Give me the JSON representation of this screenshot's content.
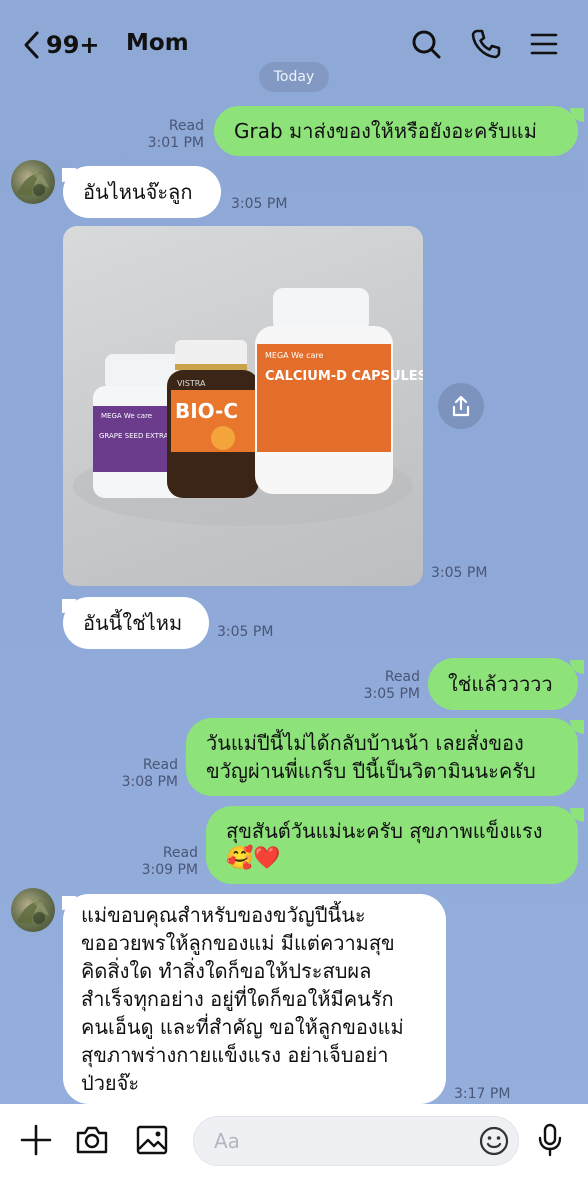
{
  "header": {
    "back_count": "99+",
    "title": "Mom",
    "icons": [
      "search-icon",
      "phone-icon",
      "menu-icon"
    ]
  },
  "date_separator": "Today",
  "messages": [
    {
      "side": "out",
      "text": "Grab มาส่งของให้หรือยังอะครับแม่",
      "status": "Read",
      "time": "3:01 PM"
    },
    {
      "side": "in",
      "text": "อันไหนจ๊ะลูก",
      "time": "3:05 PM"
    },
    {
      "side": "in",
      "type": "image",
      "image_text": {
        "left_brand": "MEGA We care",
        "left_product": "GRAPE SEED EXTRACT 20 mg",
        "middle_brand": "VISTRA",
        "middle_product": "BIO-C",
        "right_brand": "MEGA We care",
        "right_product": "CALCIUM-D CAPSULES"
      },
      "time": "3:05 PM"
    },
    {
      "side": "in",
      "text": "อันนี้ใช่ไหม",
      "time": "3:05 PM"
    },
    {
      "side": "out",
      "text": "ใช่แล้ววววว",
      "status": "Read",
      "time": "3:05 PM"
    },
    {
      "side": "out",
      "lines": [
        "วันแม่ปีนี้ไม่ได้กลับบ้านน้า เลยสั่งของ",
        "ขวัญผ่านพี่แกร็บ ปีนี้เป็นวิตามินนะครับ"
      ],
      "status": "Read",
      "time": "3:08 PM"
    },
    {
      "side": "out",
      "lines": [
        "สุขสันต์วันแม่นะครับ สุขภาพแข็งแรง",
        "🥰❤️"
      ],
      "status": "Read",
      "time": "3:09 PM"
    },
    {
      "side": "in",
      "lines": [
        "แม่ขอบคุณสำหรับของขวัญปีนี้นะ",
        "ขออวยพรให้ลูกของแม่ มีแต่ความสุข",
        "คิดสิ่งใด ทำสิ่งใดก็ขอให้ประสบผล",
        "สำเร็จทุกอย่าง อยู่ที่ใดก็ขอให้มีคนรัก",
        "คนเอ็นดู และที่สำคัญ ขอให้ลูกของแม่",
        "สุขภาพร่างกายแข็งแรง อย่าเจ็บอย่า",
        "ป่วยจ๊ะ"
      ],
      "time": "3:17 PM"
    }
  ],
  "input": {
    "placeholder": "Aa"
  },
  "bottom_icons": [
    "plus-icon",
    "camera-icon",
    "image-icon",
    "emoji-icon",
    "mic-icon"
  ],
  "colors": {
    "outgoing_bubble": "#8de37a",
    "incoming_bubble": "#ffffff",
    "background": "#8fa9d6"
  }
}
